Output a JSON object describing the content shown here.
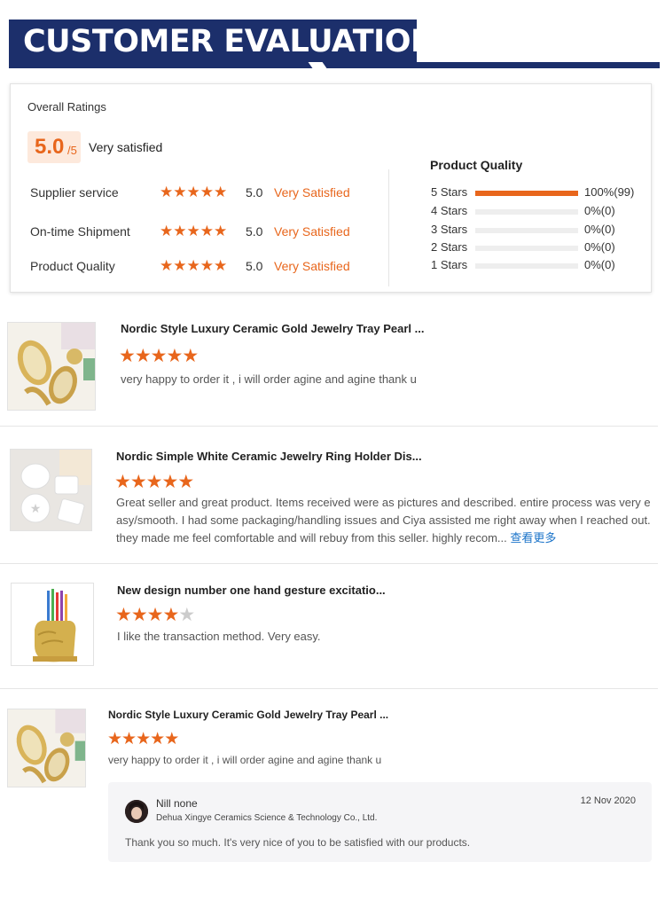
{
  "banner": {
    "title": "CUSTOMER EVALUATION",
    "color": "#1c2f6b"
  },
  "summary": {
    "overall_label": "Overall Ratings",
    "score": "5.0",
    "score_denominator": "/5",
    "score_text": "Very satisfied",
    "ratings": [
      {
        "label": "Supplier service",
        "stars": "★★★★★",
        "score": "5.0",
        "text": "Very Satisfied"
      },
      {
        "label": "On-time Shipment",
        "stars": "★★★★★",
        "score": "5.0",
        "text": "Very Satisfied"
      },
      {
        "label": "Product Quality",
        "stars": "★★★★★",
        "score": "5.0",
        "text": "Very Satisfied"
      }
    ],
    "quality_title": "Product Quality",
    "distribution": [
      {
        "label": "5 Stars",
        "count": "100%(99)",
        "fraction": 1.0
      },
      {
        "label": "4 Stars",
        "count": "0%(0)",
        "fraction": 0
      },
      {
        "label": "3 Stars",
        "count": "0%(0)",
        "fraction": 0
      },
      {
        "label": "2 Stars",
        "count": "0%(0)",
        "fraction": 0
      },
      {
        "label": "1 Stars",
        "count": "0%(0)",
        "fraction": 0
      }
    ]
  },
  "reviews": [
    {
      "title": "Nordic Style Luxury Ceramic Gold Jewelry Tray Pearl ...",
      "rating": 5,
      "body": "very happy to order it , i will order agine and agine thank u",
      "image": "gold-pineapple-tray-icon"
    },
    {
      "title": "Nordic Simple White Ceramic Jewelry Ring Holder Dis...",
      "rating": 5,
      "body": "Great seller and great product. Items received were as pictures and described. entire process was very easy/smooth. I had some packaging/handling issues and Ciya assisted me right away when I reached out. they made me feel comfortable and will rebuy from this seller. highly recom...",
      "more_link": "查看更多",
      "image": "white-ceramic-tray-icon"
    },
    {
      "title": "New design number one hand gesture excitatio...",
      "rating": 4,
      "body": "I like the transaction method. Very easy.",
      "image": "gold-hand-pen-holder-icon"
    },
    {
      "title": "Nordic Style Luxury Ceramic Gold Jewelry Tray Pearl ...",
      "rating": 5,
      "body": "very happy to order it , i will order agine and agine thank u",
      "image": "gold-pineapple-tray-icon"
    }
  ],
  "reply": {
    "name": "Nill none",
    "company": "Dehua Xingye Ceramics Science & Technology Co., Ltd.",
    "date": "12 Nov 2020",
    "body": "Thank you so much. It's very nice of you to be satisfied with our products."
  },
  "colors": {
    "accent": "#e8661c",
    "link": "#1a73c9"
  }
}
